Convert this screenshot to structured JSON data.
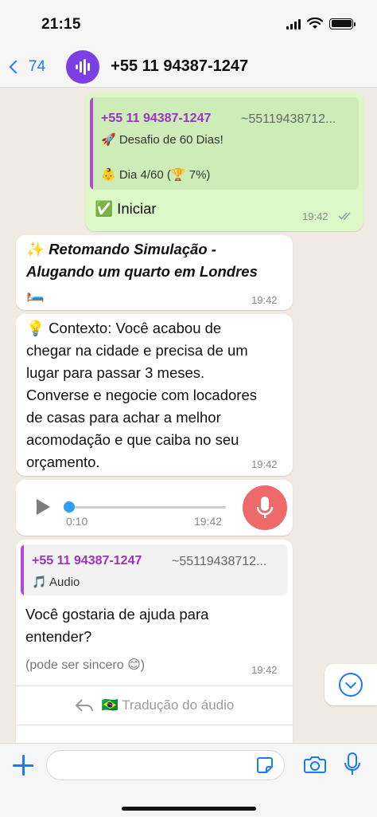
{
  "status": {
    "time": "21:15"
  },
  "header": {
    "back_count": "74",
    "contact_name": "+55 11 94387-1247"
  },
  "messages": {
    "m1": {
      "quote_name": "+55 11 94387-1247",
      "quote_phone": "~55119438712...",
      "quote_line1": "🚀 Desafio de 60 Dias!",
      "quote_line2": "👶 Dia 4/60 (🏆 7%)",
      "text": "✅ Iniciar",
      "time": "19:42"
    },
    "m2": {
      "prefix": "✨ ",
      "title_line1": "Retomando Simulação -",
      "title_line2": "Alugando um quarto em Londres",
      "suffix": "🛏️",
      "time": "19:42"
    },
    "m3": {
      "line1": "💡 Contexto: Você acabou de",
      "line2": "chegar na cidade e precisa de um",
      "line3": "lugar para passar 3 meses.",
      "line4": "Converse e negocie com locadores",
      "line5": "de casas para achar a melhor",
      "line6": "acomodação e que caiba no seu",
      "line7": "orçamento.",
      "time": "19:42"
    },
    "m4": {
      "duration": "0:10",
      "time": "19:42",
      "progress": 0
    },
    "m5": {
      "quote_name": "+55 11 94387-1247",
      "quote_phone": "~55119438712...",
      "quote_line": "🎵 Audio",
      "line1": "Você gostaria de ajuda para",
      "line2": "entender?",
      "note": "(pode ser sincero 😊)",
      "time": "19:42",
      "action_label": "🇧🇷 Tradução do áudio"
    }
  },
  "input": {
    "placeholder": ""
  },
  "colors": {
    "accent": "#1a7cf5",
    "outgoing": "#dcf8c6",
    "quote_name": "#9b33c2",
    "mic": "#ef6a6a"
  }
}
